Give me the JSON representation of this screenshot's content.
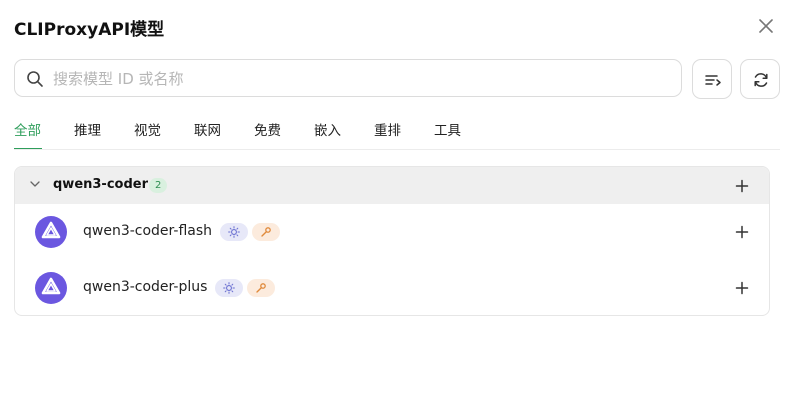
{
  "dialog": {
    "title": "CLIProxyAPI模型",
    "close_icon": "close-icon"
  },
  "search": {
    "placeholder": "搜索模型 ID 或名称",
    "value": ""
  },
  "toolbar": {
    "sort_icon": "sort-list-icon",
    "refresh_icon": "refresh-icon"
  },
  "tabs": [
    {
      "label": "全部",
      "active": true
    },
    {
      "label": "推理",
      "active": false
    },
    {
      "label": "视觉",
      "active": false
    },
    {
      "label": "联网",
      "active": false
    },
    {
      "label": "免费",
      "active": false
    },
    {
      "label": "嵌入",
      "active": false
    },
    {
      "label": "重排",
      "active": false
    },
    {
      "label": "工具",
      "active": false
    }
  ],
  "groups": [
    {
      "name": "qwen3-coder",
      "count": "2",
      "expanded": true,
      "models": [
        {
          "name": "qwen3-coder-flash",
          "capabilities": [
            "vision",
            "tools"
          ]
        },
        {
          "name": "qwen3-coder-plus",
          "capabilities": [
            "vision",
            "tools"
          ]
        }
      ]
    }
  ],
  "colors": {
    "accent": "#2e9e5b",
    "model_logo": "#6b57e0",
    "vision_chip_bg": "#e7e8f8",
    "vision_chip_fg": "#6a6fd1",
    "tools_chip_bg": "#fcebdd",
    "tools_chip_fg": "#e08a3c"
  }
}
